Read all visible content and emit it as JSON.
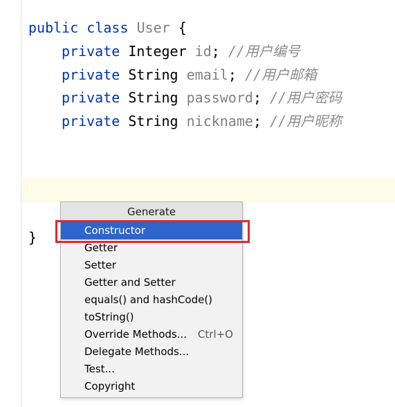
{
  "code": {
    "line1": {
      "kw1": "public",
      "kw2": "class",
      "name": "User",
      "brace": "{"
    },
    "fields": [
      {
        "modifier": "private",
        "type": "Integer",
        "name": "id",
        "semi": ";",
        "comment": "//用户编号"
      },
      {
        "modifier": "private",
        "type": "String",
        "name": "email",
        "semi": ";",
        "comment": "//用户邮箱"
      },
      {
        "modifier": "private",
        "type": "String",
        "name": "password",
        "semi": ";",
        "comment": "//用户密码"
      },
      {
        "modifier": "private",
        "type": "String",
        "name": "nickname",
        "semi": ";",
        "comment": "//用户昵称"
      }
    ],
    "closing_brace": "}"
  },
  "generate_popup": {
    "title": "Generate",
    "items": [
      {
        "label": "Constructor",
        "shortcut": "",
        "selected": true
      },
      {
        "label": "Getter",
        "shortcut": ""
      },
      {
        "label": "Setter",
        "shortcut": ""
      },
      {
        "label": "Getter and Setter",
        "shortcut": ""
      },
      {
        "label": "equals() and hashCode()",
        "shortcut": ""
      },
      {
        "label": "toString()",
        "shortcut": ""
      },
      {
        "label": "Override Methods...",
        "shortcut": "Ctrl+O"
      },
      {
        "label": "Delegate Methods...",
        "shortcut": ""
      },
      {
        "label": "Test...",
        "shortcut": ""
      },
      {
        "label": "Copyright",
        "shortcut": ""
      }
    ]
  },
  "colors": {
    "keyword": "#0033b3",
    "selection": "#2f65ca",
    "annotation_box": "#e0292b",
    "current_line": "#fefbe7"
  }
}
